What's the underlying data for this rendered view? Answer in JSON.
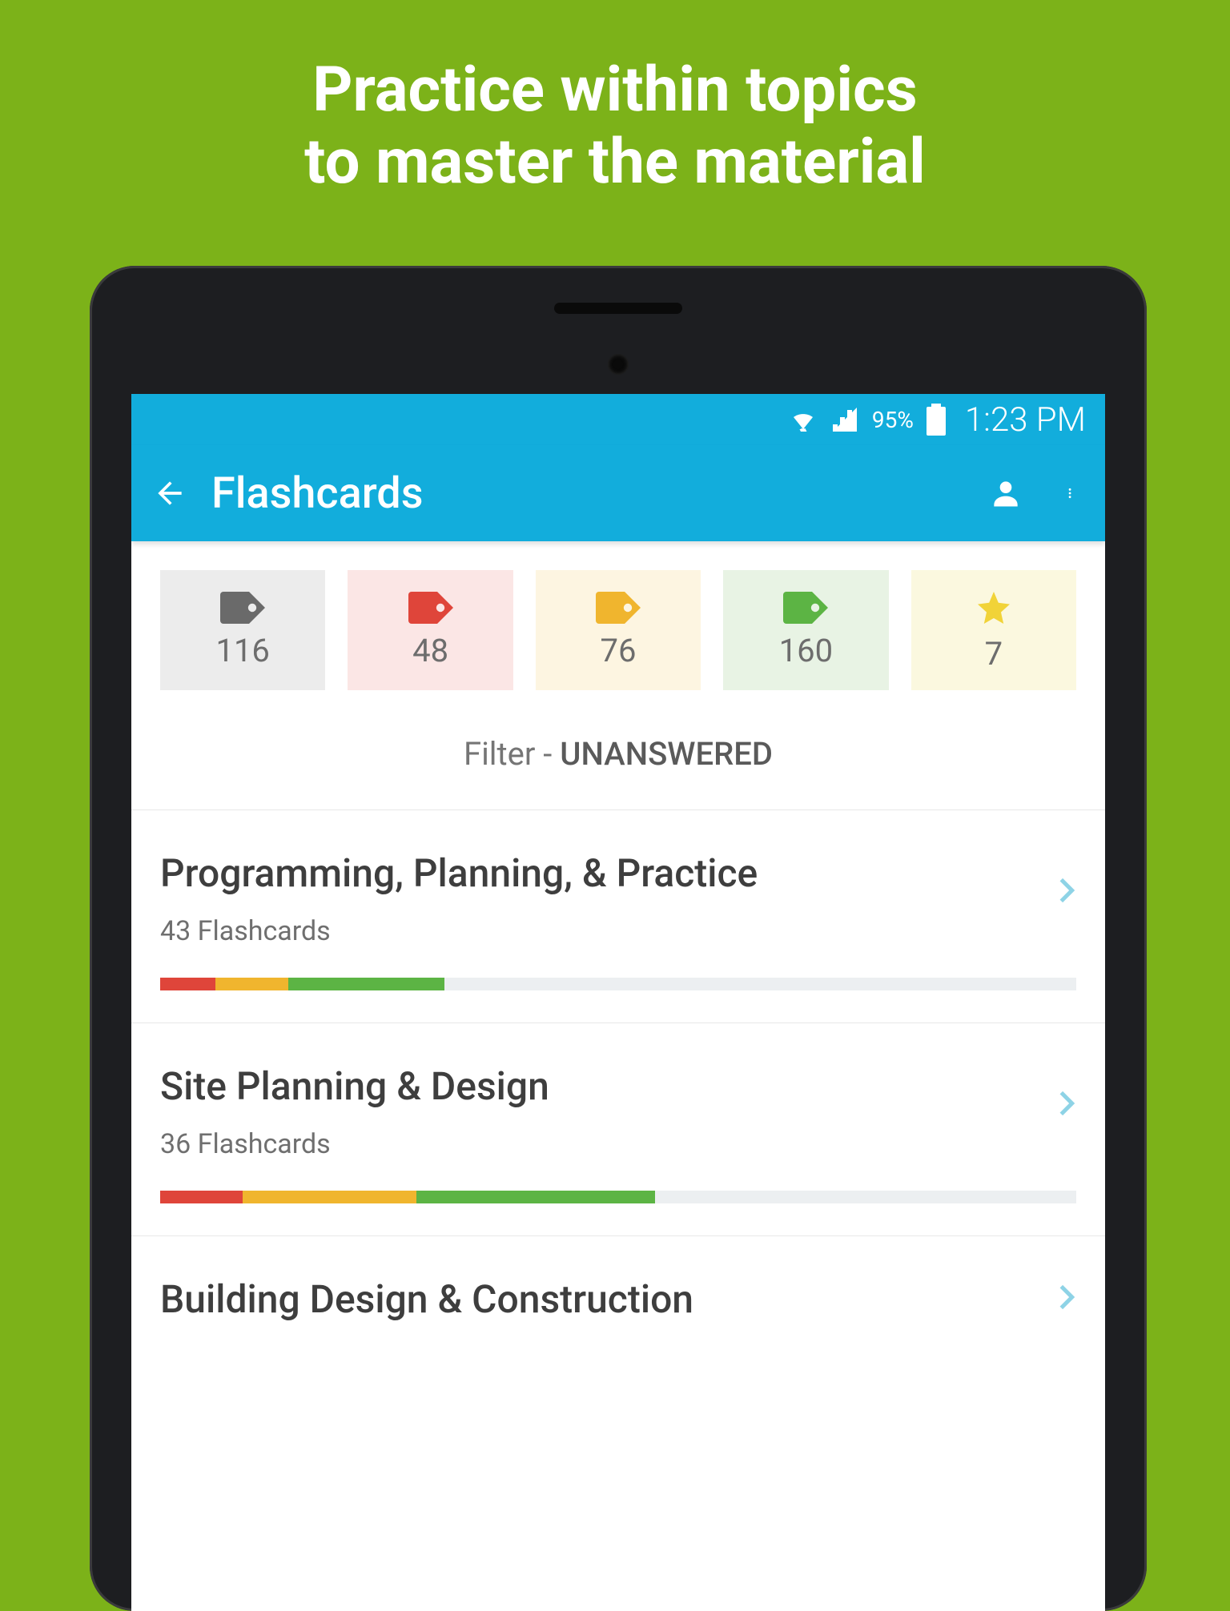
{
  "promo": {
    "line1": "Practice within topics",
    "line2": "to master the material"
  },
  "status": {
    "battery_pct": "95%",
    "time": "1:23 PM"
  },
  "appbar": {
    "title": "Flashcards"
  },
  "filters": {
    "gray_count": "116",
    "red_count": "48",
    "yellow_count": "76",
    "green_count": "160",
    "star_count": "7",
    "label_prefix": "Filter - ",
    "label_value": "UNANSWERED"
  },
  "topics": [
    {
      "title": "Programming, Planning, & Practice",
      "subtitle": "43 Flashcards",
      "progress": {
        "red": 6,
        "yellow": 8,
        "green": 17
      }
    },
    {
      "title": "Site Planning & Design",
      "subtitle": "36 Flashcards",
      "progress": {
        "red": 9,
        "yellow": 19,
        "green": 26
      }
    },
    {
      "title": "Building Design & Construction",
      "subtitle": "",
      "progress": {
        "red": 0,
        "yellow": 0,
        "green": 0
      }
    }
  ],
  "colors": {
    "tag_gray": "#6a6a6a",
    "tag_red": "#df453a",
    "tag_yellow": "#f0b52e",
    "tag_green": "#5cb444",
    "star": "#f1d338",
    "chevron": "#8ed3e6"
  }
}
